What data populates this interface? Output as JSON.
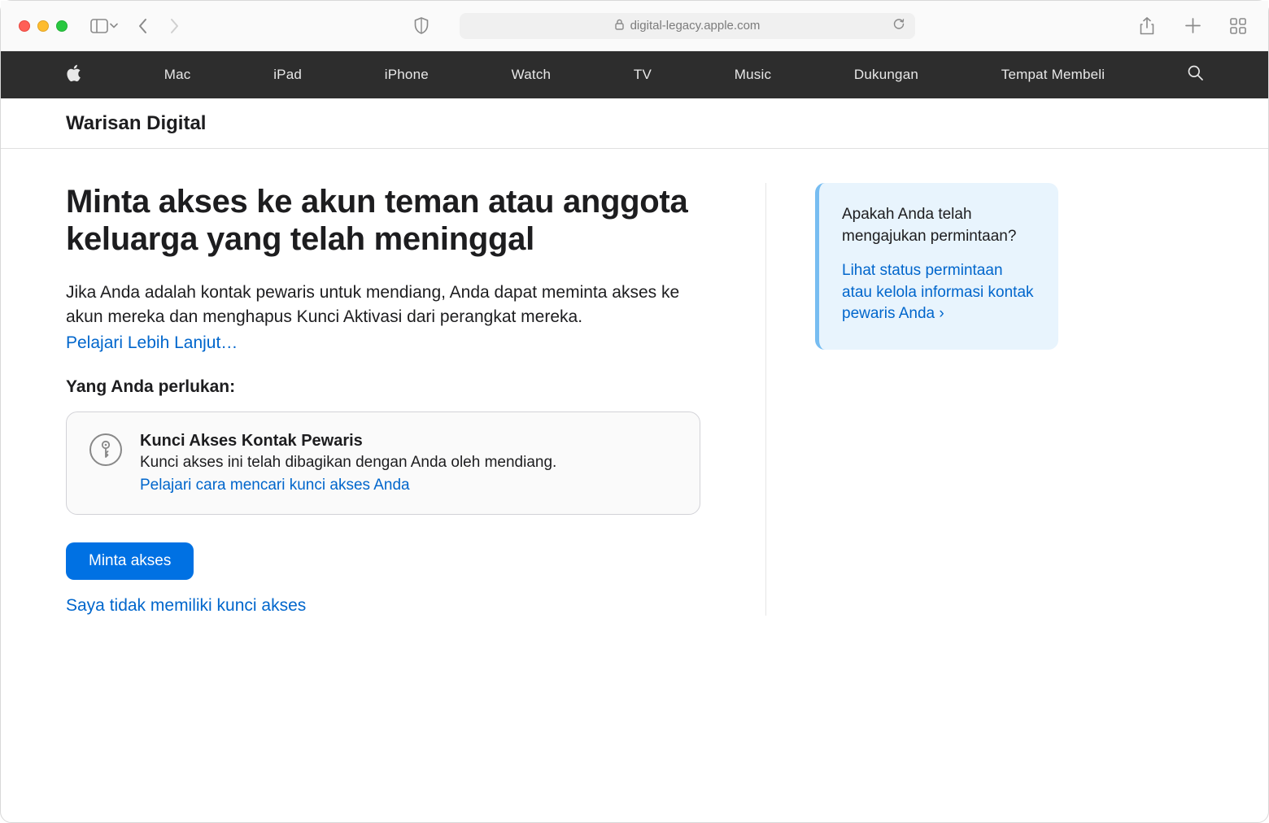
{
  "browser": {
    "url": "digital-legacy.apple.com"
  },
  "globalNav": {
    "items": [
      "Mac",
      "iPad",
      "iPhone",
      "Watch",
      "TV",
      "Music",
      "Dukungan",
      "Tempat Membeli"
    ]
  },
  "localNav": {
    "title": "Warisan Digital"
  },
  "main": {
    "title": "Minta akses ke akun teman atau anggota keluarga yang telah meninggal",
    "intro": "Jika Anda adalah kontak pewaris untuk mendiang, Anda dapat meminta akses ke akun mereka dan menghapus Kunci Aktivasi dari perangkat mereka.",
    "learnMore": "Pelajari Lebih Lanjut…",
    "needLabel": "Yang Anda perlukan:",
    "card": {
      "title": "Kunci Akses Kontak Pewaris",
      "desc": "Kunci akses ini telah dibagikan dengan Anda oleh mendiang.",
      "link": "Pelajari cara mencari kunci akses Anda"
    },
    "primaryBtn": "Minta akses",
    "secondaryLink": "Saya tidak memiliki kunci akses"
  },
  "callout": {
    "title": "Apakah Anda telah mengajukan permintaan?",
    "link": "Lihat status permintaan atau kelola informasi kontak pewaris Anda ›"
  }
}
